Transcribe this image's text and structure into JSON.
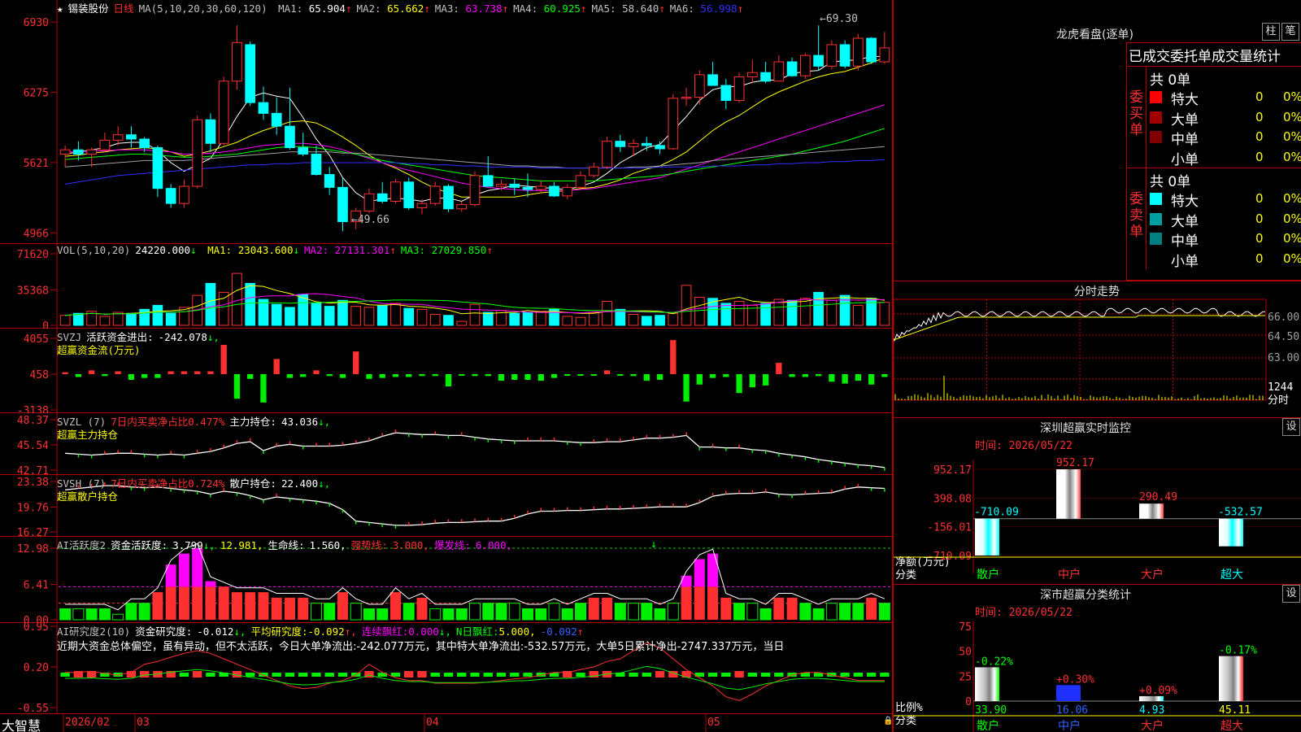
{
  "stock": {
    "star": "★",
    "name": "锡装股份",
    "period": "日线",
    "ma_label": "MA(5,10,20,30,60,120)",
    "ma": [
      {
        "k": "MA1:",
        "v": "65.904",
        "a": "↑",
        "c": "#ffffff"
      },
      {
        "k": "MA2:",
        "v": "65.662",
        "a": "↑",
        "c": "#ffff00"
      },
      {
        "k": "MA3:",
        "v": "63.738",
        "a": "↑",
        "c": "#ff00ff"
      },
      {
        "k": "MA4:",
        "v": "60.925",
        "a": "↑",
        "c": "#00ff00"
      },
      {
        "k": "MA5:",
        "v": "58.640",
        "a": "↑",
        "c": "#c0c0c0"
      },
      {
        "k": "MA6:",
        "v": "56.998",
        "a": "↑",
        "c": "#3030ff"
      }
    ],
    "price_ticks": [
      "6930",
      "6275",
      "5621",
      "4966"
    ],
    "high_label": "69.30",
    "low_label": "49.66"
  },
  "vol": {
    "label": "VOL(5,10,20)",
    "value": "24220.000",
    "arrow": "↓",
    "mas": [
      {
        "k": "MA1:",
        "v": "23043.600",
        "a": "↓",
        "c": "#ffff00"
      },
      {
        "k": "MA2:",
        "v": "27131.301",
        "a": "↑",
        "c": "#ff00ff"
      },
      {
        "k": "MA3:",
        "v": "27029.850",
        "a": "↑",
        "c": "#00ff00"
      }
    ],
    "ticks": [
      "71620",
      "35368",
      "0"
    ]
  },
  "svzj": {
    "label": "SVZJ",
    "desc": "活跃资金进出:",
    "value": "-242.078",
    "arrow": "↓,",
    "sub": "超赢资金流(万元)",
    "ticks": [
      "4055",
      "458",
      "-3138"
    ]
  },
  "svzl": {
    "label": "SVZL (7)",
    "desc": "7日内买卖净占比0.477%",
    "k2": "主力持仓:",
    "v2": "43.036",
    "a2": "↓,",
    "sub": "超赢主力持仓",
    "ticks": [
      "48.37",
      "45.54",
      "42.71"
    ]
  },
  "svsh": {
    "label": "SVSH (7)",
    "desc": "7日内买卖净占比0.724%",
    "k2": "散户持仓:",
    "v2": "22.400",
    "a2": "↓,",
    "sub": "超赢散户持仓",
    "ticks": [
      "23.38",
      "19.76",
      "16.27"
    ]
  },
  "ai1": {
    "label": "AI活跃度2",
    "k1": "资金活跃度:",
    "v1": "3.799",
    "a1": "↓,",
    "v2": "12.981,",
    "k3": "生命线:",
    "v3": "1.560,",
    "k4": "强势线:",
    "v4": "3.000,",
    "k5": "爆发线:",
    "v5": "6.000,",
    "ticks": [
      "12.98",
      "6.41",
      "0.00"
    ]
  },
  "ai2": {
    "label": "AI研究度2(10)",
    "k1": "资金研究度:",
    "v1": "-0.012",
    "a1": "↓,",
    "k2": "平均研究度:",
    "v2": "-0.092",
    "a2": "↑,",
    "k3": "连续飘红:",
    "v3": "0.000",
    "a3": "↓,",
    "k4": "N日飘红:",
    "v4": "5.000,",
    "v5": "-0.092",
    "a5": "↑",
    "text": "近期大资金总体偏空，虽有异动，但不太活跃，今日大单净流出:-242.077万元，其中特大单净流出:-532.57万元，大单5日累计净出-2747.337万元，当日",
    "ticks": [
      "0.95",
      "0.20",
      "-0.55"
    ]
  },
  "bottom": {
    "brand": "大智慧",
    "year_month": "2026/02",
    "months": [
      "03",
      "04",
      "05"
    ],
    "lock": "🔒"
  },
  "lhb": {
    "title": "龙虎看盘(逐单)",
    "btn_bar": "柱",
    "btn_pen": "笔",
    "header": "已成交委托单成交量统计",
    "buy": {
      "side": "委买单",
      "total": "共 0单",
      "rows": [
        {
          "n": "特大",
          "v": "0",
          "p": "0%",
          "c": "#ff0000"
        },
        {
          "n": "大单",
          "v": "0",
          "p": "0%",
          "c": "#a00000"
        },
        {
          "n": "中单",
          "v": "0",
          "p": "0%",
          "c": "#800000"
        },
        {
          "n": "小单",
          "v": "0",
          "p": "0%",
          "c": ""
        }
      ]
    },
    "sell": {
      "side": "委卖单",
      "total": "共 0单",
      "rows": [
        {
          "n": "特大",
          "v": "0",
          "p": "0%",
          "c": "#00ffff"
        },
        {
          "n": "大单",
          "v": "0",
          "p": "0%",
          "c": "#00a0a0"
        },
        {
          "n": "中单",
          "v": "0",
          "p": "0%",
          "c": "#008080"
        },
        {
          "n": "小单",
          "v": "0",
          "p": "0%",
          "c": ""
        }
      ]
    }
  },
  "fenshi": {
    "title": "分时走势",
    "ticks": [
      "66.00",
      "64.50",
      "63.00"
    ],
    "vol_tick": "1244",
    "vol_unit": "分时"
  },
  "sz_monitor": {
    "title": "深圳超赢实时监控",
    "btn": "设",
    "time": "时间: 2026/05/22",
    "ticks": [
      "952.17",
      "398.08",
      "-156.01",
      "-710.09"
    ],
    "ylabel": "净额(万元)",
    "xlabel": "分类",
    "cats": [
      "散户",
      "中户",
      "大户",
      "超大"
    ],
    "values": [
      -710.09,
      952.17,
      290.49,
      -532.57
    ],
    "labels": [
      "-710.09",
      "952.17",
      "290.49",
      "-532.57"
    ]
  },
  "sz_class": {
    "title": "深市超赢分类统计",
    "btn": "设",
    "time": "时间: 2026/05/22",
    "ticks": [
      "75",
      "50",
      "25",
      "0"
    ],
    "ylabel": "比例%",
    "xlabel": "分类",
    "cats": [
      "散户",
      "中户",
      "大户",
      "超大"
    ],
    "values": [
      33.9,
      16.06,
      4.93,
      45.11
    ],
    "top": [
      "-0.22%",
      "+0.30%",
      "+0.09%",
      "-0.17%"
    ],
    "labels": [
      "33.90",
      "16.06",
      "4.93",
      "45.11"
    ],
    "colors": [
      "#00ff00",
      "#3030ff",
      "#00ffff",
      "#ff2020"
    ]
  },
  "chart_data": {
    "type": "candlestick",
    "title": "锡装股份 日线",
    "ylim": [
      4966,
      6930
    ],
    "candles": [
      [
        5700,
        5780,
        5580,
        5740
      ],
      [
        5740,
        5820,
        5640,
        5700
      ],
      [
        5700,
        5760,
        5580,
        5740
      ],
      [
        5740,
        5900,
        5720,
        5830
      ],
      [
        5830,
        5960,
        5780,
        5880
      ],
      [
        5880,
        5960,
        5760,
        5840
      ],
      [
        5840,
        5860,
        5720,
        5760
      ],
      [
        5760,
        5780,
        5300,
        5380
      ],
      [
        5380,
        5420,
        5200,
        5240
      ],
      [
        5240,
        5460,
        5200,
        5400
      ],
      [
        5400,
        6060,
        5380,
        6020
      ],
      [
        6020,
        6080,
        5720,
        5800
      ],
      [
        5800,
        6420,
        5780,
        6380
      ],
      [
        6380,
        6900,
        6300,
        6740
      ],
      [
        6720,
        6750,
        6150,
        6180
      ],
      [
        6180,
        6330,
        6020,
        6080
      ],
      [
        6080,
        6230,
        5880,
        5960
      ],
      [
        5960,
        6320,
        5740,
        5760
      ],
      [
        5760,
        5900,
        5680,
        5700
      ],
      [
        5700,
        5780,
        5500,
        5510
      ],
      [
        5510,
        5580,
        5320,
        5390
      ],
      [
        5390,
        5480,
        4980,
        5070
      ],
      [
        5070,
        5200,
        5000,
        5170
      ],
      [
        5170,
        5380,
        5150,
        5330
      ],
      [
        5330,
        5440,
        5240,
        5260
      ],
      [
        5260,
        5470,
        5240,
        5440
      ],
      [
        5440,
        5480,
        5180,
        5200
      ],
      [
        5200,
        5280,
        5140,
        5240
      ],
      [
        5240,
        5440,
        5220,
        5400
      ],
      [
        5400,
        5420,
        5160,
        5190
      ],
      [
        5190,
        5260,
        5160,
        5230
      ],
      [
        5230,
        5540,
        5210,
        5500
      ],
      [
        5500,
        5680,
        5460,
        5400
      ],
      [
        5400,
        5460,
        5360,
        5420
      ],
      [
        5420,
        5470,
        5320,
        5390
      ],
      [
        5390,
        5520,
        5300,
        5370
      ],
      [
        5370,
        5450,
        5340,
        5400
      ],
      [
        5400,
        5440,
        5300,
        5310
      ],
      [
        5310,
        5420,
        5280,
        5390
      ],
      [
        5390,
        5540,
        5380,
        5500
      ],
      [
        5500,
        5620,
        5480,
        5580
      ],
      [
        5580,
        5860,
        5560,
        5820
      ],
      [
        5820,
        5880,
        5720,
        5770
      ],
      [
        5770,
        5840,
        5680,
        5800
      ],
      [
        5800,
        5860,
        5730,
        5780
      ],
      [
        5780,
        5820,
        5700,
        5750
      ],
      [
        5750,
        6260,
        5740,
        6220
      ],
      [
        6220,
        6320,
        6150,
        6230
      ],
      [
        6230,
        6480,
        6160,
        6440
      ],
      [
        6440,
        6560,
        6380,
        6340
      ],
      [
        6340,
        6400,
        6120,
        6200
      ],
      [
        6200,
        6460,
        6180,
        6420
      ],
      [
        6420,
        6580,
        6360,
        6460
      ],
      [
        6460,
        6560,
        6360,
        6380
      ],
      [
        6380,
        6620,
        6380,
        6560
      ],
      [
        6560,
        6600,
        6420,
        6430
      ],
      [
        6430,
        6640,
        6400,
        6620
      ],
      [
        6620,
        6900,
        6480,
        6520
      ],
      [
        6520,
        6760,
        6490,
        6720
      ],
      [
        6720,
        6760,
        6500,
        6520
      ],
      [
        6520,
        6820,
        6480,
        6780
      ],
      [
        6780,
        6790,
        6540,
        6560
      ],
      [
        6560,
        6840,
        6540,
        6690
      ]
    ],
    "ma": {
      "MA1": [
        5700,
        5720,
        5740,
        5760,
        5800,
        5810,
        5810,
        5730,
        5620,
        5540,
        5600,
        5660,
        5840,
        6050,
        6230,
        6270,
        6240,
        6220,
        6040,
        5840,
        5690,
        5480,
        5340,
        5260,
        5280,
        5290,
        5280,
        5260,
        5290,
        5290,
        5260,
        5320,
        5360,
        5380,
        5410,
        5400,
        5390,
        5380,
        5370,
        5400,
        5440,
        5520,
        5620,
        5690,
        5760,
        5790,
        5920,
        6050,
        6200,
        6300,
        6330,
        6330,
        6370,
        6390,
        6390,
        6450,
        6470,
        6480,
        6560,
        6570,
        6580,
        6610,
        6610
      ],
      "MA2": [
        5680,
        5690,
        5710,
        5720,
        5740,
        5750,
        5760,
        5750,
        5720,
        5680,
        5700,
        5730,
        5770,
        5810,
        5870,
        5920,
        5960,
        6000,
        6010,
        5990,
        5930,
        5860,
        5780,
        5690,
        5620,
        5570,
        5510,
        5440,
        5380,
        5340,
        5300,
        5300,
        5300,
        5300,
        5300,
        5320,
        5340,
        5350,
        5360,
        5380,
        5390,
        5420,
        5460,
        5520,
        5560,
        5590,
        5650,
        5720,
        5820,
        5920,
        6000,
        6060,
        6140,
        6220,
        6280,
        6330,
        6380,
        6420,
        6450,
        6470,
        6510,
        6550,
        6600
      ],
      "MA3": [
        5720,
        5720,
        5730,
        5730,
        5740,
        5740,
        5740,
        5730,
        5720,
        5700,
        5700,
        5710,
        5720,
        5740,
        5760,
        5780,
        5790,
        5800,
        5800,
        5790,
        5770,
        5740,
        5700,
        5660,
        5620,
        5580,
        5550,
        5520,
        5490,
        5460,
        5430,
        5410,
        5390,
        5380,
        5370,
        5360,
        5360,
        5360,
        5360,
        5370,
        5380,
        5400,
        5420,
        5440,
        5460,
        5480,
        5520,
        5560,
        5600,
        5640,
        5680,
        5720,
        5760,
        5800,
        5840,
        5880,
        5920,
        5960,
        6000,
        6040,
        6080,
        6120,
        6160
      ],
      "MA4": [
        5650,
        5660,
        5670,
        5680,
        5690,
        5700,
        5700,
        5690,
        5680,
        5670,
        5670,
        5680,
        5690,
        5700,
        5720,
        5740,
        5760,
        5770,
        5770,
        5760,
        5740,
        5720,
        5700,
        5670,
        5640,
        5620,
        5600,
        5580,
        5560,
        5540,
        5520,
        5500,
        5490,
        5480,
        5470,
        5460,
        5450,
        5450,
        5450,
        5450,
        5450,
        5460,
        5470,
        5480,
        5490,
        5500,
        5520,
        5540,
        5560,
        5580,
        5600,
        5620,
        5640,
        5660,
        5680,
        5700,
        5730,
        5760,
        5790,
        5820,
        5860,
        5900,
        5940
      ],
      "MA5": [
        5580,
        5590,
        5600,
        5610,
        5620,
        5630,
        5640,
        5640,
        5640,
        5640,
        5650,
        5660,
        5670,
        5680,
        5690,
        5700,
        5710,
        5720,
        5720,
        5720,
        5720,
        5710,
        5710,
        5700,
        5690,
        5680,
        5670,
        5660,
        5650,
        5640,
        5630,
        5620,
        5610,
        5600,
        5590,
        5590,
        5580,
        5580,
        5570,
        5570,
        5570,
        5570,
        5570,
        5580,
        5580,
        5590,
        5600,
        5610,
        5620,
        5640,
        5650,
        5660,
        5670,
        5680,
        5690,
        5700,
        5710,
        5720,
        5730,
        5740,
        5750,
        5760,
        5770
      ],
      "MA6": [
        5420,
        5440,
        5460,
        5480,
        5500,
        5510,
        5520,
        5530,
        5540,
        5550,
        5560,
        5570,
        5580,
        5590,
        5600,
        5600,
        5610,
        5610,
        5620,
        5620,
        5620,
        5620,
        5620,
        5620,
        5620,
        5620,
        5610,
        5610,
        5600,
        5600,
        5590,
        5590,
        5580,
        5580,
        5580,
        5580,
        5570,
        5570,
        5570,
        5570,
        5570,
        5570,
        5570,
        5570,
        5570,
        5580,
        5580,
        5580,
        5580,
        5590,
        5590,
        5590,
        5600,
        5600,
        5610,
        5610,
        5620,
        5620,
        5630,
        5630,
        5640,
        5640,
        5650
      ]
    },
    "volume": [
      10000,
      12000,
      14000,
      9000,
      13000,
      12000,
      16000,
      20000,
      12000,
      18000,
      30000,
      42000,
      33000,
      52000,
      42000,
      26000,
      21000,
      18000,
      31000,
      22000,
      19000,
      25000,
      19000,
      18000,
      20000,
      22000,
      17000,
      16000,
      11000,
      10000,
      4000,
      21000,
      13000,
      15000,
      12000,
      13000,
      14000,
      16000,
      9000,
      8000,
      13000,
      24000,
      16000,
      11000,
      9000,
      10000,
      12000,
      40000,
      28000,
      27000,
      22000,
      24000,
      20000,
      22000,
      26000,
      25000,
      27000,
      33000,
      25000,
      30000,
      20000,
      27000,
      23000
    ],
    "svzj": [
      200,
      -300,
      400,
      -200,
      300,
      -600,
      -400,
      -400,
      300,
      300,
      300,
      300,
      3100,
      -2600,
      -500,
      -3000,
      1600,
      -400,
      -300,
      400,
      -200,
      -400,
      2400,
      -500,
      -400,
      -300,
      -300,
      -200,
      -200,
      -1300,
      -100,
      -200,
      -200,
      -700,
      -600,
      -600,
      -700,
      -400,
      -100,
      -100,
      -100,
      400,
      -100,
      -200,
      -700,
      -600,
      3600,
      -2900,
      -1100,
      -400,
      -300,
      -2000,
      -1400,
      -1200,
      1200,
      -300,
      -300,
      -200,
      -800,
      -1000,
      -700,
      -1100,
      -300
    ],
    "zl": [
      44.6,
      44.5,
      44.4,
      44.5,
      44.6,
      44.6,
      44.5,
      44.4,
      44.5,
      44.4,
      44.6,
      44.8,
      45.2,
      45.7,
      45.9,
      44.9,
      45.4,
      45.6,
      45.4,
      45.4,
      45.4,
      45.5,
      45.7,
      46.0,
      46.5,
      46.9,
      46.8,
      46.7,
      46.7,
      46.6,
      46.6,
      46.4,
      46.2,
      46.1,
      46.0,
      46.0,
      46.0,
      46.0,
      45.9,
      45.8,
      45.8,
      45.9,
      45.9,
      46.1,
      46.3,
      46.3,
      46.4,
      46.6,
      45.3,
      45.3,
      45.2,
      45.2,
      45.0,
      44.9,
      44.6,
      44.4,
      44.2,
      43.9,
      43.7,
      43.5,
      43.3,
      43.2,
      43.0
    ],
    "sh": [
      22.2,
      22.4,
      22.6,
      22.8,
      22.8,
      22.6,
      22.5,
      22.6,
      22.4,
      22.2,
      22.0,
      21.6,
      22.0,
      21.8,
      21.4,
      20.8,
      21.2,
      21.0,
      20.8,
      20.6,
      20.3,
      19.4,
      17.8,
      17.6,
      17.4,
      17.2,
      17.2,
      17.3,
      17.5,
      17.6,
      17.6,
      17.7,
      17.8,
      17.8,
      18.2,
      18.8,
      19.2,
      19.2,
      19.3,
      19.3,
      19.4,
      19.5,
      19.5,
      19.6,
      19.7,
      19.8,
      19.8,
      19.8,
      20.4,
      21.3,
      21.6,
      21.7,
      21.7,
      21.9,
      21.6,
      21.5,
      21.6,
      21.7,
      21.8,
      22.3,
      22.6,
      22.5,
      22.4
    ],
    "ai1": [
      2,
      2,
      2,
      2,
      1,
      3,
      3,
      5,
      10,
      12,
      13,
      7,
      6,
      5,
      5,
      5,
      4,
      4,
      4,
      3,
      3,
      5,
      3,
      2,
      2,
      5,
      3,
      4,
      2,
      2,
      2,
      3,
      3,
      3,
      3,
      2,
      2,
      3,
      2,
      3,
      4,
      4,
      3,
      3,
      3,
      2,
      3,
      8,
      11,
      12,
      4,
      3,
      3,
      2,
      4,
      4,
      3,
      2,
      3,
      3,
      3,
      4,
      3
    ],
    "ai2": [
      0.05,
      0.06,
      0.1,
      0.06,
      0.05,
      0.06,
      0.1,
      0.1,
      0.05,
      0.05,
      0.06,
      0.05,
      0.05,
      0.05,
      0.05,
      0.05,
      0.05,
      0.05,
      0.05,
      0.05,
      0.05,
      0.05,
      0.05,
      0.05,
      0.05,
      0.05,
      0.05,
      0.05,
      0.05,
      0.05,
      0.05,
      0.05,
      0.05,
      0.05,
      0.05,
      0.05,
      0.05,
      0.05,
      0.05,
      0.05,
      0.05,
      0.05,
      0.05,
      0.05,
      0.05,
      0.05,
      0.05,
      0.05,
      0.05,
      0.05,
      0.05,
      0.05,
      0.05,
      0.05,
      0.05,
      0.05,
      0.05,
      0.05,
      0.05,
      0.05,
      0.05,
      0.05,
      0.05
    ]
  }
}
